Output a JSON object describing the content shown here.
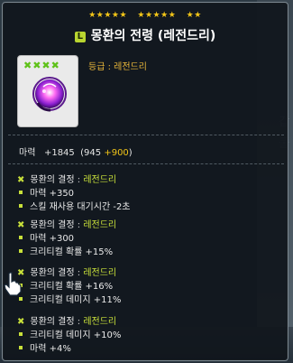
{
  "stars": {
    "group1": "★★★★★",
    "group2": "★★★★★",
    "group3": "★★"
  },
  "item": {
    "badge": "L",
    "name": "몽환의 전령 (레전드리)",
    "grade_label": "등급 : 레전드리",
    "potential_marks": "✖✖✖✖"
  },
  "stat": {
    "label": "마력",
    "value": "+1845",
    "base_open": "(945",
    "bonus": "+900",
    "close": ")"
  },
  "blocks": [
    {
      "title": "몽환의 결정",
      "colon": " : ",
      "grade": "레전드리",
      "lines": [
        "마력 +350",
        "스킬 재사용 대기시간 -2초"
      ]
    },
    {
      "title": "몽환의 결정",
      "colon": " : ",
      "grade": "레전드리",
      "lines": [
        "마력 +300",
        "크리티컬 확률 +15%"
      ]
    },
    {
      "title": "몽환의 결정",
      "colon": " : ",
      "grade": "레전드리",
      "lines": [
        "크리티컬 확률 +16%",
        "크리티컬 데미지 +11%"
      ]
    },
    {
      "title": "몽환의 결정",
      "colon": " : ",
      "grade": "레전드리",
      "lines": [
        "크리티컬 데미지 +10%",
        "마력 +4%"
      ]
    }
  ],
  "colors": {
    "star": "#f2c518",
    "legendary": "#c8e03a",
    "grade": "#e8b63a"
  },
  "icons": {
    "emblem": "purple-dream-emblem-icon",
    "cursor": "hand-pointer-icon"
  }
}
